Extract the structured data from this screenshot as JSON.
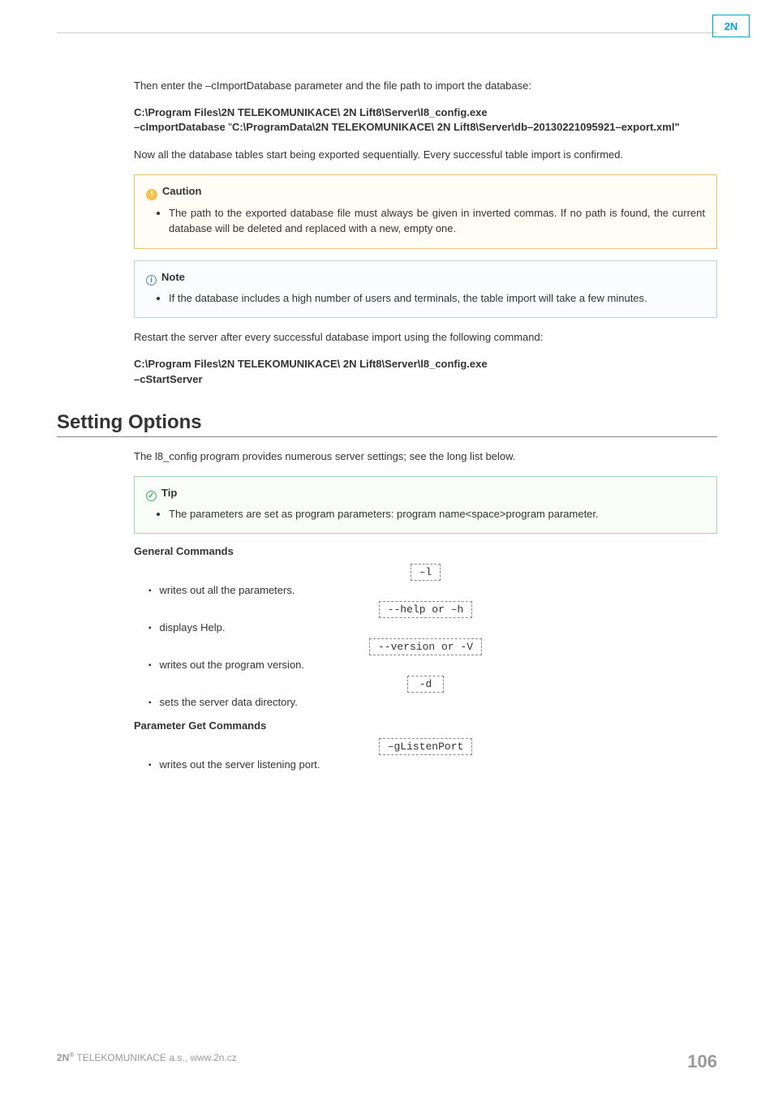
{
  "logo": "2N",
  "intro1": "Then enter the –cImportDatabase parameter and the file path to import the database:",
  "cmd1_line1": "C:\\Program Files\\2N TELEKOMUNIKACE\\ 2N Lift8\\Server\\l8_config.exe",
  "cmd1_line2a": "–cImportDatabase ",
  "cmd1_line2b": "\"",
  "cmd1_line2c": "C:\\ProgramData\\2N TELEKOMUNIKACE\\ 2N Lift8\\Server\\db–20130221095921–export.xml\"",
  "intro2": "Now all the database tables start being exported sequentially. Every successful table import is confirmed.",
  "caution_title": "Caution",
  "caution_body": "The path to the exported database file must always be given in inverted commas. If no path is found, the current database will be deleted and replaced with a new, empty one.",
  "note_title": "Note",
  "note_body": "If the database includes a high number of users and terminals, the table import will take a few minutes.",
  "restart_para": "Restart the server after every successful database import using the following command:",
  "cmd2_line1": "C:\\Program Files\\2N TELEKOMUNIKACE\\ 2N Lift8\\Server\\l8_config.exe",
  "cmd2_line2": "–cStartServer",
  "heading": "Setting Options",
  "heading_intro": "The l8_config program provides numerous server settings; see the long list below.",
  "tip_title": "Tip",
  "tip_body": "The parameters are set as program parameters: program name<space>program parameter.",
  "general_heading": "General Commands",
  "param_get_heading": "Parameter Get Commands",
  "flags": {
    "l": "–l",
    "l_desc": "writes out all the parameters.",
    "help": "--help or –h",
    "help_desc": "displays Help.",
    "version": "--version or -V",
    "version_desc": "writes out the program version.",
    "d": "-d",
    "d_desc": "sets the server data directory.",
    "glisten": "–gListenPort",
    "glisten_desc": "writes out the server listening port."
  },
  "footer_left_pre": "2N",
  "footer_left_sup": "®",
  "footer_left_post": " TELEKOMUNIKACE a.s., www.2n.cz",
  "page_no": "106"
}
